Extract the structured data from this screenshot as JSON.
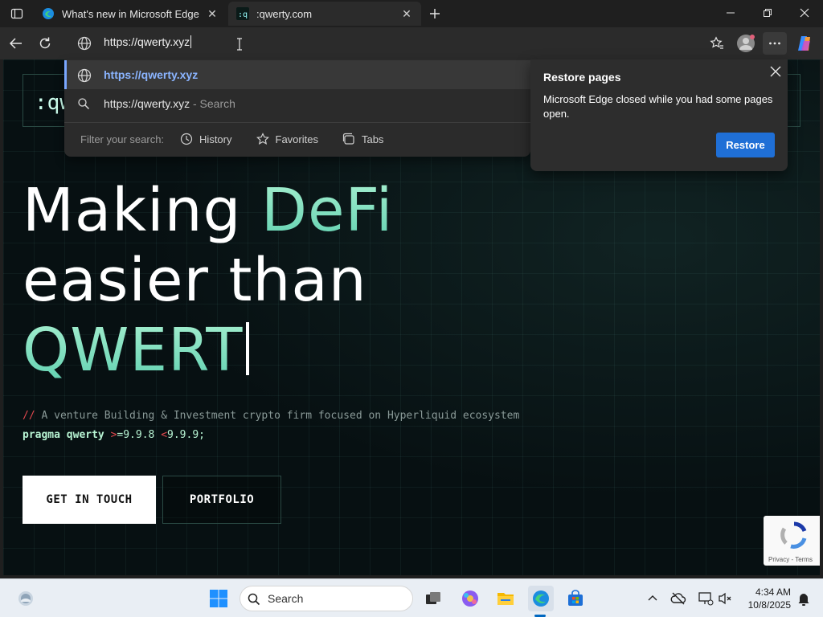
{
  "browser": {
    "tabs": [
      {
        "title": "What's new in Microsoft Edge",
        "favicon": "edge-icon"
      },
      {
        "title": ":qwerty.com",
        "favicon": "qwerty-site-icon"
      }
    ],
    "address": {
      "value": "https://qwerty.xyz"
    }
  },
  "omnibox_dropdown": {
    "suggestions": [
      {
        "text": "https://qwerty.xyz",
        "subtext": "",
        "icon": "globe-icon"
      },
      {
        "text": "https://qwerty.xyz",
        "subtext": " - Search",
        "icon": "search-icon"
      }
    ],
    "filter_label": "Filter your search:",
    "filters": [
      {
        "label": "History",
        "icon": "history-icon"
      },
      {
        "label": "Favorites",
        "icon": "star-icon"
      },
      {
        "label": "Tabs",
        "icon": "tabs-icon"
      }
    ]
  },
  "restore_flyout": {
    "title": "Restore pages",
    "body": "Microsoft Edge closed while you had some pages open.",
    "button": "Restore"
  },
  "site": {
    "logo": ":qw",
    "hero": {
      "line1a": "Making ",
      "line1b": "DeFi",
      "line2": "easier than",
      "line3": "QWERT"
    },
    "tagline_prefix": "//",
    "tagline": " A venture Building & Investment crypto firm focused on Hyperliquid ecosystem",
    "pragma": {
      "keyword": "pragma qwerty",
      "op1": " >",
      "v1": "=9.9.8",
      "op2": " <",
      "v2": "9.9.9;"
    },
    "cta_primary": "GET IN TOUCH",
    "cta_secondary": "PORTFOLIO",
    "recaptcha_text": "Privacy - Terms"
  },
  "taskbar": {
    "search_placeholder": "Search",
    "time": "4:34 AM",
    "date": "10/8/2025"
  }
}
